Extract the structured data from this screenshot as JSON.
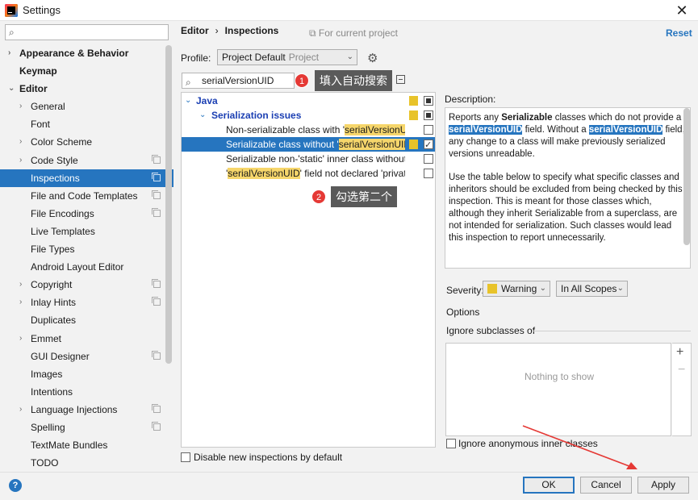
{
  "window": {
    "title": "Settings",
    "close": "✕"
  },
  "search": {
    "placeholder": "",
    "icon": "search-icon"
  },
  "sidebar": {
    "items": [
      {
        "label": "Appearance & Behavior",
        "arrow": "›",
        "bold": true,
        "indent": 0
      },
      {
        "label": "Keymap",
        "arrow": "",
        "bold": true,
        "indent": 0
      },
      {
        "label": "Editor",
        "arrow": "⌄",
        "bold": true,
        "indent": 0
      },
      {
        "label": "General",
        "arrow": "›",
        "indent": 1
      },
      {
        "label": "Font",
        "arrow": "",
        "indent": 1
      },
      {
        "label": "Color Scheme",
        "arrow": "›",
        "indent": 1
      },
      {
        "label": "Code Style",
        "arrow": "›",
        "indent": 1,
        "copy": true
      },
      {
        "label": "Inspections",
        "arrow": "",
        "indent": 1,
        "copy": true,
        "selected": true
      },
      {
        "label": "File and Code Templates",
        "arrow": "",
        "indent": 1,
        "copy": true
      },
      {
        "label": "File Encodings",
        "arrow": "",
        "indent": 1,
        "copy": true
      },
      {
        "label": "Live Templates",
        "arrow": "",
        "indent": 1
      },
      {
        "label": "File Types",
        "arrow": "",
        "indent": 1
      },
      {
        "label": "Android Layout Editor",
        "arrow": "",
        "indent": 1
      },
      {
        "label": "Copyright",
        "arrow": "›",
        "indent": 1,
        "copy": true
      },
      {
        "label": "Inlay Hints",
        "arrow": "›",
        "indent": 1,
        "copy": true
      },
      {
        "label": "Duplicates",
        "arrow": "",
        "indent": 1
      },
      {
        "label": "Emmet",
        "arrow": "›",
        "indent": 1
      },
      {
        "label": "GUI Designer",
        "arrow": "",
        "indent": 1,
        "copy": true
      },
      {
        "label": "Images",
        "arrow": "",
        "indent": 1
      },
      {
        "label": "Intentions",
        "arrow": "",
        "indent": 1
      },
      {
        "label": "Language Injections",
        "arrow": "›",
        "indent": 1,
        "copy": true
      },
      {
        "label": "Spelling",
        "arrow": "",
        "indent": 1,
        "copy": true
      },
      {
        "label": "TextMate Bundles",
        "arrow": "",
        "indent": 1
      },
      {
        "label": "TODO",
        "arrow": "",
        "indent": 1
      }
    ]
  },
  "header": {
    "crumb_parent": "Editor",
    "crumb_sep": "›",
    "crumb_current": "Inspections",
    "scope": "⧉ For current project",
    "reset": "Reset"
  },
  "profile": {
    "label": "Profile:",
    "value": "Project Default",
    "suffix": "Project",
    "chevron": "⌄",
    "gear": "⚙"
  },
  "filter": {
    "value": "serialVersionUID",
    "icon": "⌕"
  },
  "tree": {
    "java": "Java",
    "group": "Serialization issues",
    "items": [
      {
        "before": "Non-serializable class with '",
        "hl": "serialVersionUID",
        "after": "'",
        "checked": false,
        "selected": false
      },
      {
        "before": "Serializable class without '",
        "hl": "serialVersionUID",
        "after": "'",
        "checked": true,
        "selected": true
      },
      {
        "before": "Serializable non-'static' inner class without '",
        "hl": "",
        "after": "",
        "checked": false,
        "selected": false
      },
      {
        "before": "'",
        "hl": "serialVersionUID",
        "after": "' field not declared 'private",
        "checked": false,
        "selected": false
      }
    ]
  },
  "disable_new": "Disable new inspections by default",
  "description": {
    "label": "Description:",
    "p1_a": "Reports any ",
    "p1_b": "Serializable",
    "p1_c": " classes which do not provide a ",
    "p1_kw1": "serialVersionUID",
    "p1_d": " field. Without a ",
    "p1_kw2": "serialVersionUID",
    "p1_e": " field, any change to a class will make previously serialized versions unreadable.",
    "p2": "Use the table below to specify what specific classes and inheritors should be excluded from being checked by this inspection. This is meant for those classes which, although they inherit Serializable from a superclass, are not intended for serialization. Such classes would lead this inspection to report unnecessarily."
  },
  "severity": {
    "label": "Severity:",
    "value": "Warning",
    "scope": "In All Scopes",
    "color": "#e8c32a"
  },
  "options": {
    "label": "Options",
    "ignore_sub": "Ignore subclasses of",
    "empty": "Nothing to show",
    "add": "+",
    "remove": "−",
    "ignore_anon": "Ignore anonymous inner classes"
  },
  "footer": {
    "help": "?",
    "ok": "OK",
    "cancel": "Cancel",
    "apply": "Apply"
  },
  "annotations": {
    "badge1": "1",
    "callout1": "填入自动搜索",
    "badge2": "2",
    "callout2": "勾选第二个"
  },
  "colors": {
    "accent": "#2675bf",
    "highlight": "#f6d66b",
    "warning": "#e8c32a",
    "annotation": "#e53935"
  }
}
